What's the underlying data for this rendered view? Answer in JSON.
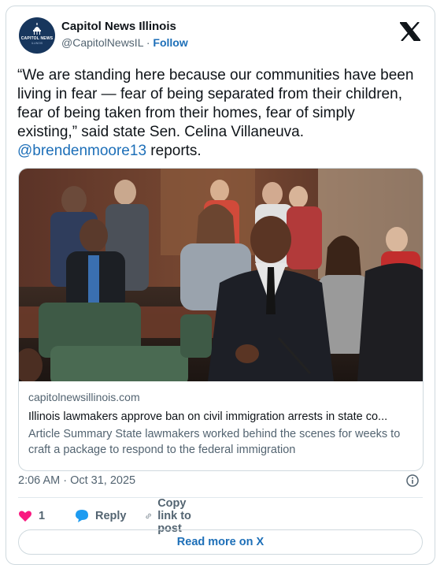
{
  "account": {
    "name": "Capitol News Illinois",
    "handle": "@CapitolNewsIL",
    "separator": "·",
    "follow_label": "Follow",
    "avatar_text": "CAPITOL NEWS",
    "avatar_subtext": "ILLINOIS"
  },
  "tweet": {
    "text": "“We are standing here because our communities have been living in fear — fear of being separated from their children, fear of being taken from their homes, fear of simply existing,” said state Sen. Celina Villaneuva.",
    "mention": "@brendenmoore13",
    "text_after": " reports."
  },
  "link_card": {
    "domain": "capitolnewsillinois.com",
    "title": "Illinois lawmakers approve ban on civil immigration arrests in state co...",
    "description": "Article Summary State lawmakers worked behind the scenes for weeks to craft a package to respond to the federal immigration"
  },
  "timestamp": "2:06 AM · Oct 31, 2025",
  "actions": {
    "like_count": "1",
    "reply_label": "Reply",
    "copy_label": "Copy link to post"
  },
  "read_more_label": "Read more on X",
  "colors": {
    "accent": "#1d6fb8",
    "like": "#f91880",
    "muted": "#536471",
    "border": "#cfd9de"
  },
  "icons": [
    "x-logo-icon",
    "info-icon",
    "heart-icon",
    "reply-bubble-icon",
    "link-icon"
  ]
}
